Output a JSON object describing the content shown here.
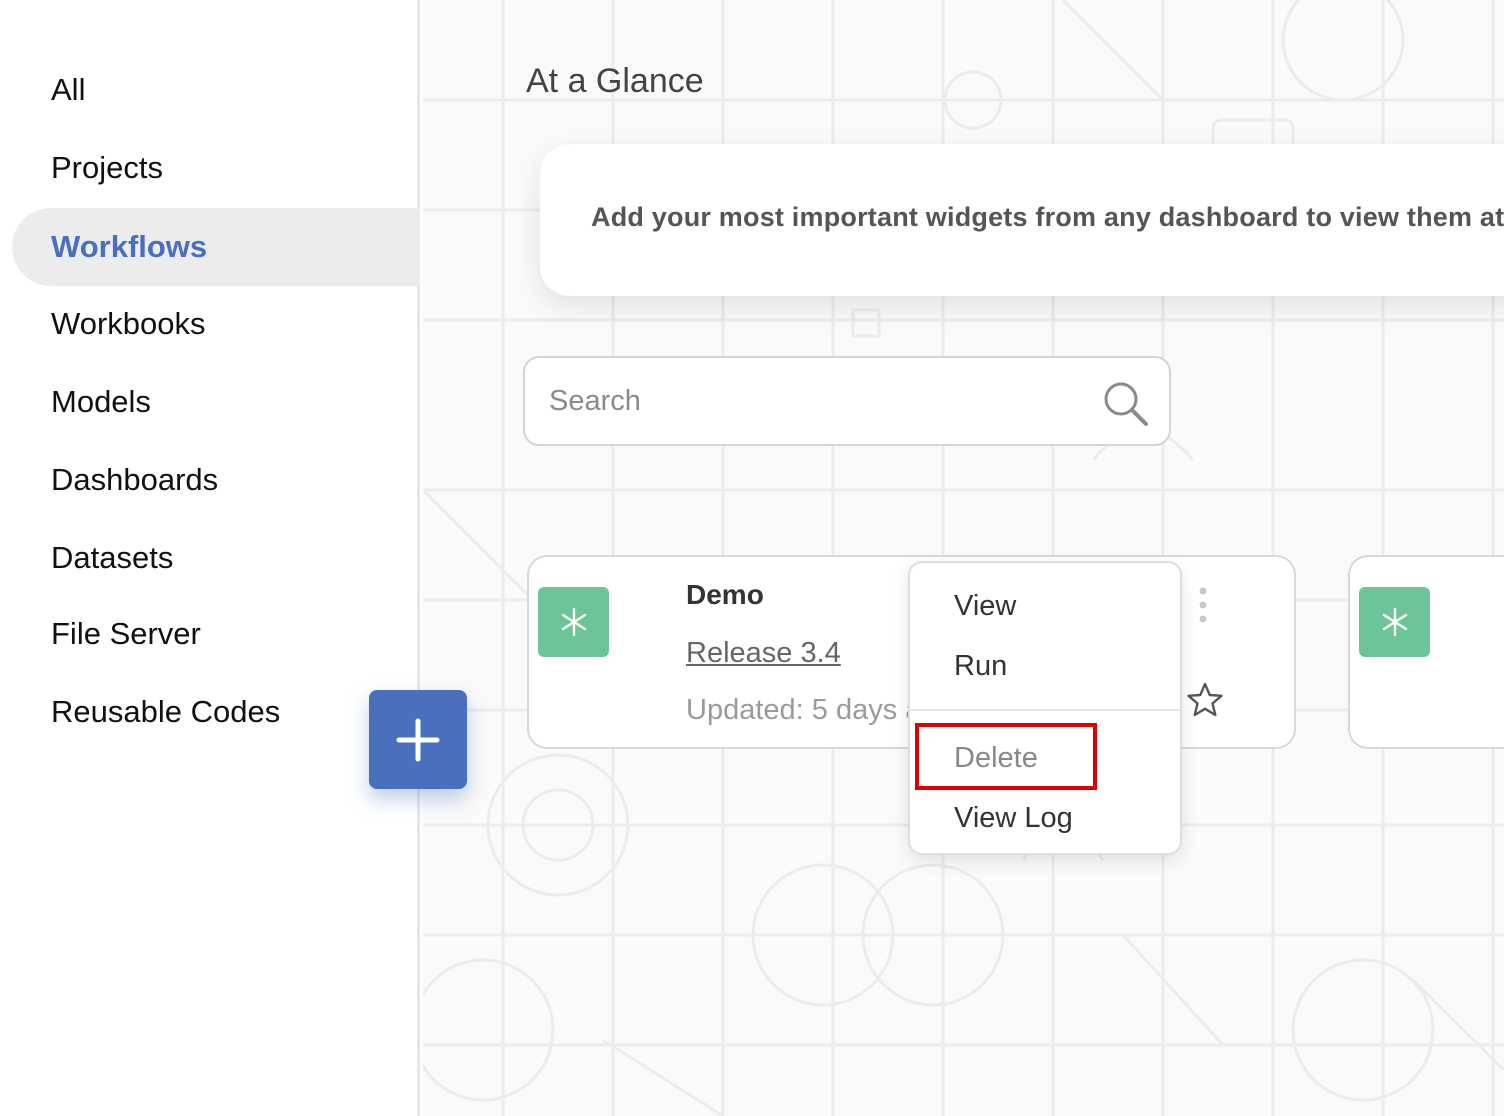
{
  "sidebar": {
    "items": [
      {
        "label": "All",
        "active": false
      },
      {
        "label": "Projects",
        "active": false
      },
      {
        "label": "Workflows",
        "active": true
      },
      {
        "label": "Workbooks",
        "active": false
      },
      {
        "label": "Models",
        "active": false
      },
      {
        "label": "Dashboards",
        "active": false
      },
      {
        "label": "Datasets",
        "active": false
      },
      {
        "label": "File Server",
        "active": false
      },
      {
        "label": "Reusable Codes",
        "active": false
      }
    ]
  },
  "fab": {
    "icon": "plus-icon"
  },
  "main": {
    "title": "At a Glance",
    "glance_message": "Add your most important widgets from any dashboard to view them at a",
    "search": {
      "placeholder": "Search",
      "value": "",
      "icon": "search-icon"
    },
    "cards": [
      {
        "title": "Demo",
        "version": "Release 3.4",
        "updated": "Updated: 5 days a",
        "icon": "workflow-asterisk-icon",
        "icon_color": "#6cc596"
      },
      {
        "icon": "workflow-asterisk-icon",
        "icon_color": "#6cc596"
      }
    ],
    "context_menu": {
      "items": [
        "View",
        "Run",
        "Delete",
        "View Log"
      ],
      "highlighted": "Delete"
    }
  },
  "colors": {
    "accent": "#4a6fbd",
    "highlight": "#e00000",
    "icon_green": "#6cc596"
  }
}
